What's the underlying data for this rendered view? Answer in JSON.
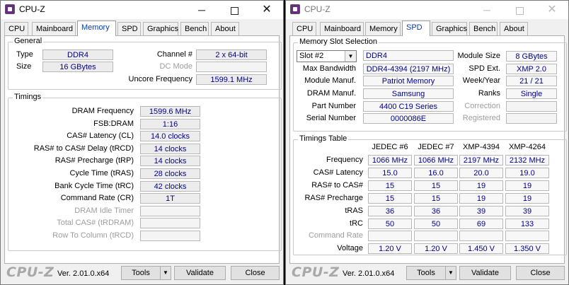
{
  "left": {
    "title": "CPU-Z",
    "tabs": [
      "CPU",
      "Mainboard",
      "Memory",
      "SPD",
      "Graphics",
      "Bench",
      "About"
    ],
    "active_tab": "Memory",
    "general": {
      "label": "General",
      "type_label": "Type",
      "type": "DDR4",
      "size_label": "Size",
      "size": "16 GBytes",
      "channel_label": "Channel #",
      "channel": "2 x 64-bit",
      "dcmode_label": "DC Mode",
      "dcmode": "",
      "uncore_label": "Uncore Frequency",
      "uncore": "1599.1 MHz"
    },
    "timings": {
      "label": "Timings",
      "rows": [
        {
          "label": "DRAM Frequency",
          "value": "1599.6 MHz",
          "enabled": true
        },
        {
          "label": "FSB:DRAM",
          "value": "1:16",
          "enabled": true
        },
        {
          "label": "CAS# Latency (CL)",
          "value": "14.0 clocks",
          "enabled": true
        },
        {
          "label": "RAS# to CAS# Delay (tRCD)",
          "value": "14 clocks",
          "enabled": true
        },
        {
          "label": "RAS# Precharge (tRP)",
          "value": "14 clocks",
          "enabled": true
        },
        {
          "label": "Cycle Time (tRAS)",
          "value": "28 clocks",
          "enabled": true
        },
        {
          "label": "Bank Cycle Time (tRC)",
          "value": "42 clocks",
          "enabled": true
        },
        {
          "label": "Command Rate (CR)",
          "value": "1T",
          "enabled": true
        },
        {
          "label": "DRAM Idle Timer",
          "value": "",
          "enabled": false
        },
        {
          "label": "Total CAS# (tRDRAM)",
          "value": "",
          "enabled": false
        },
        {
          "label": "Row To Column (tRCD)",
          "value": "",
          "enabled": false
        }
      ]
    }
  },
  "right": {
    "title": "CPU-Z",
    "tabs": [
      "CPU",
      "Mainboard",
      "Memory",
      "SPD",
      "Graphics",
      "Bench",
      "About"
    ],
    "active_tab": "SPD",
    "slot_selection": {
      "label": "Memory Slot Selection",
      "slot": "Slot #2",
      "type": "DDR4",
      "module_size_label": "Module Size",
      "module_size": "8 GBytes",
      "max_bw_label": "Max Bandwidth",
      "max_bw": "DDR4-4394 (2197 MHz)",
      "spd_ext_label": "SPD Ext.",
      "spd_ext": "XMP 2.0",
      "module_manuf_label": "Module Manuf.",
      "module_manuf": "Patriot Memory",
      "week_year_label": "Week/Year",
      "week_year": "21 / 21",
      "dram_manuf_label": "DRAM Manuf.",
      "dram_manuf": "Samsung",
      "ranks_label": "Ranks",
      "ranks": "Single",
      "part_label": "Part Number",
      "part": "4400 C19 Series",
      "correction_label": "Correction",
      "correction": "",
      "serial_label": "Serial Number",
      "serial": "0000086E",
      "registered_label": "Registered",
      "registered": ""
    },
    "timings_table": {
      "label": "Timings Table",
      "columns": [
        "JEDEC #6",
        "JEDEC #7",
        "XMP-4394",
        "XMP-4264"
      ],
      "rows": [
        {
          "label": "Frequency",
          "values": [
            "1066 MHz",
            "1066 MHz",
            "2197 MHz",
            "2132 MHz"
          ],
          "enabled": true
        },
        {
          "label": "CAS# Latency",
          "values": [
            "15.0",
            "16.0",
            "20.0",
            "19.0"
          ],
          "enabled": true
        },
        {
          "label": "RAS# to CAS#",
          "values": [
            "15",
            "15",
            "19",
            "19"
          ],
          "enabled": true
        },
        {
          "label": "RAS# Precharge",
          "values": [
            "15",
            "15",
            "19",
            "19"
          ],
          "enabled": true
        },
        {
          "label": "tRAS",
          "values": [
            "36",
            "36",
            "39",
            "39"
          ],
          "enabled": true
        },
        {
          "label": "tRC",
          "values": [
            "50",
            "50",
            "69",
            "133"
          ],
          "enabled": true
        },
        {
          "label": "Command Rate",
          "values": [
            "",
            "",
            "",
            ""
          ],
          "enabled": false
        },
        {
          "label": "Voltage",
          "values": [
            "1.20 V",
            "1.20 V",
            "1.450 V",
            "1.350 V"
          ],
          "enabled": true
        }
      ]
    }
  },
  "footer": {
    "logo": "CPU-Z",
    "version": "Ver. 2.01.0.x64",
    "tools": "Tools",
    "validate": "Validate",
    "close": "Close"
  },
  "icons": {
    "app": "cpu-z-app-icon",
    "minimize": "minimize-icon",
    "maximize": "maximize-icon",
    "close": "close-icon",
    "dropdown": "chevron-down-icon"
  },
  "colors": {
    "value_text": "#00008b",
    "active_tab_text": "#0a3ca8",
    "disabled_text": "#9d9d9d",
    "logo": "#a8a8a8"
  }
}
